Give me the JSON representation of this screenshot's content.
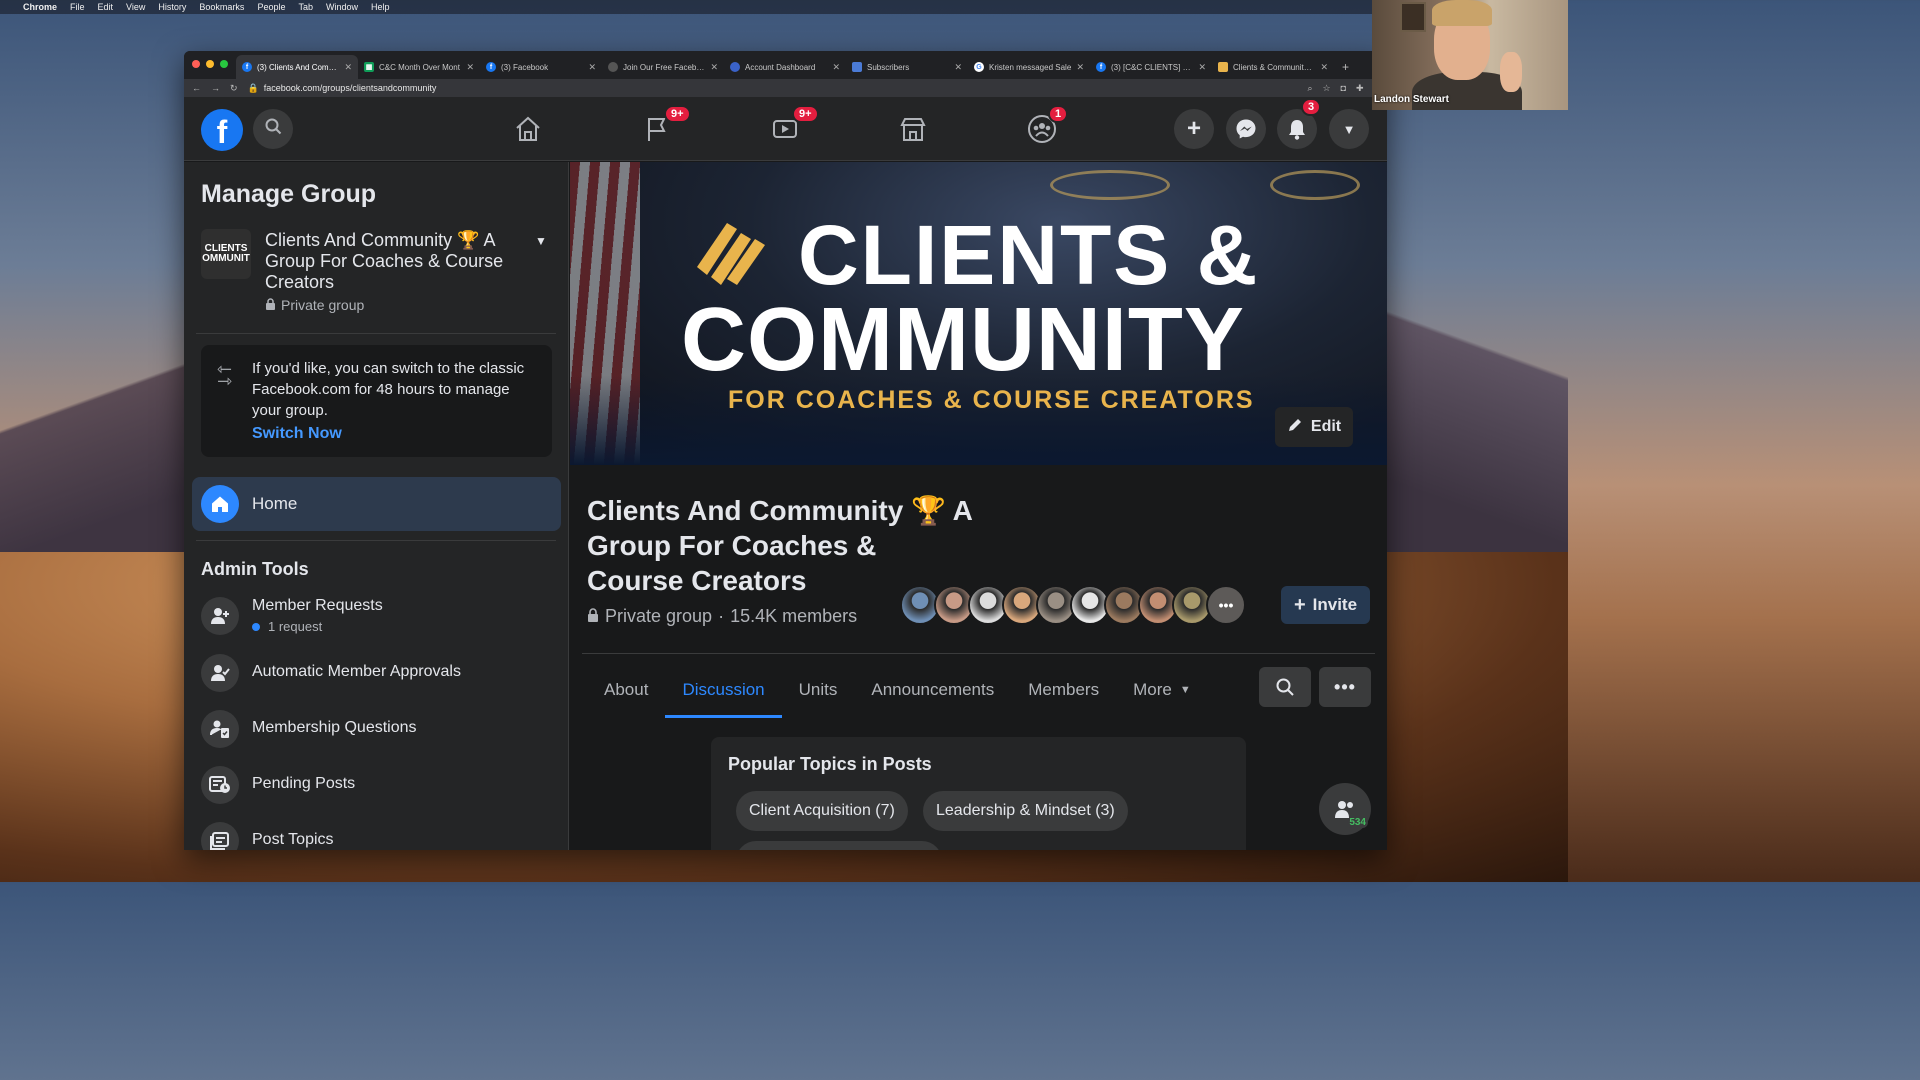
{
  "menubar": {
    "app": "Chrome",
    "items": [
      "File",
      "Edit",
      "View",
      "History",
      "Bookmarks",
      "People",
      "Tab",
      "Window",
      "Help"
    ]
  },
  "browser": {
    "tabs": [
      {
        "title": "(3) Clients And Commu",
        "icon": "facebook-icon",
        "active": true
      },
      {
        "title": "C&C Month Over Mont",
        "icon": "sheets-icon"
      },
      {
        "title": "(3) Facebook",
        "icon": "facebook-icon"
      },
      {
        "title": "Join Our Free Facebook",
        "icon": "page-icon"
      },
      {
        "title": "Account Dashboard",
        "icon": "account-icon"
      },
      {
        "title": "Subscribers",
        "icon": "mail-icon"
      },
      {
        "title": "Kristen messaged Sale",
        "icon": "google-icon"
      },
      {
        "title": "(3) [C&C CLIENTS] Pro",
        "icon": "facebook-icon"
      },
      {
        "title": "Clients & Community M",
        "icon": "cc-icon"
      }
    ],
    "url": "facebook.com/groups/clientsandcommunity"
  },
  "fbnav": {
    "logo": "f",
    "badges": {
      "pages": "9+",
      "watch": "9+",
      "groups": "1",
      "notifications": "3"
    }
  },
  "sidebar": {
    "title": "Manage Group",
    "thumb_text": "CLIENTS OMMUNIT",
    "group_name": "Clients And Community 🏆 A Group For Coaches & Course Creators",
    "privacy": "Private group",
    "switch_text": "If you'd like, you can switch to the classic Facebook.com for 48 hours to manage your group.",
    "switch_link": "Switch Now",
    "home": "Home",
    "admin_title": "Admin Tools",
    "tools": [
      {
        "label": "Member Requests",
        "sub": "1 request"
      },
      {
        "label": "Automatic Member Approvals"
      },
      {
        "label": "Membership Questions"
      },
      {
        "label": "Pending Posts"
      },
      {
        "label": "Post Topics"
      }
    ]
  },
  "cover": {
    "line1": "CLIENTS &",
    "line2": "COMMUNITY",
    "line3": "FOR COACHES & COURSE CREATORS",
    "edit": "Edit"
  },
  "group": {
    "title": "Clients And Community 🏆 A Group For Coaches & Course Creators",
    "privacy": "Private group",
    "separator": "·",
    "members": "15.4K members",
    "avatar_colors": [
      "#6f8fb5",
      "#c79a86",
      "#dcdcdc",
      "#d8a77c",
      "#9a8f84",
      "#e7e7e7",
      "#9b7a5f",
      "#c28e72",
      "#a8996b",
      "#5d5a58"
    ],
    "invite": "Invite"
  },
  "tabs": [
    {
      "label": "About"
    },
    {
      "label": "Discussion",
      "active": true
    },
    {
      "label": "Units"
    },
    {
      "label": "Announcements"
    },
    {
      "label": "Members"
    },
    {
      "label": "More"
    }
  ],
  "topics": {
    "title": "Popular Topics in Posts",
    "chips": [
      "Client Acquisition (7)",
      "Leadership & Mindset (3)"
    ]
  },
  "online_count": "534",
  "webcam": {
    "name": "Landon Stewart"
  },
  "colors": {
    "fb_blue": "#1877f2",
    "link_blue": "#2d88ff",
    "badge_red": "#e41e3f",
    "cover_gold": "#e9b44c"
  }
}
